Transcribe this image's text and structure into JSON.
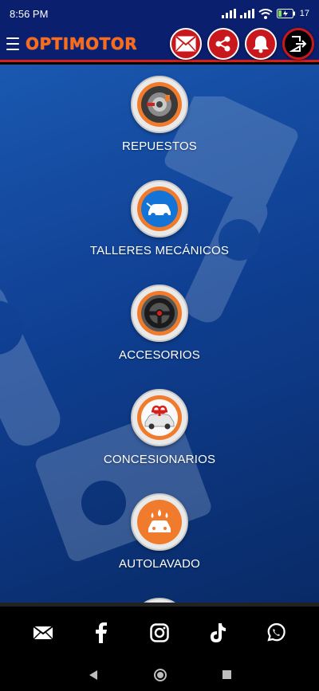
{
  "status": {
    "time": "8:56 PM",
    "battery": "17"
  },
  "app": {
    "logo": "OPTIMOTOR"
  },
  "colors": {
    "brand_orange": "#ff6a17",
    "header_blue": "#0a1f6e",
    "action_red": "#c9181d"
  },
  "actions": [
    {
      "name": "mail-button",
      "icon": "envelope-icon"
    },
    {
      "name": "share-button",
      "icon": "share-icon"
    },
    {
      "name": "notifications-button",
      "icon": "bell-icon"
    },
    {
      "name": "logout-button",
      "icon": "logout-icon"
    }
  ],
  "menu": {
    "items": [
      {
        "label": "REPUESTOS",
        "icon": "parts-icon"
      },
      {
        "label": "TALLERES MECÁNICOS",
        "icon": "car-repair-icon"
      },
      {
        "label": "ACCESORIOS",
        "icon": "steering-wheel-icon"
      },
      {
        "label": "CONCESIONARIOS",
        "icon": "gift-car-icon"
      },
      {
        "label": "AUTOLAVADO",
        "icon": "car-wash-icon"
      }
    ]
  },
  "social": [
    {
      "name": "email",
      "icon": "envelope-icon"
    },
    {
      "name": "facebook",
      "icon": "facebook-icon"
    },
    {
      "name": "instagram",
      "icon": "instagram-icon"
    },
    {
      "name": "tiktok",
      "icon": "tiktok-icon"
    },
    {
      "name": "whatsapp",
      "icon": "whatsapp-icon"
    }
  ]
}
